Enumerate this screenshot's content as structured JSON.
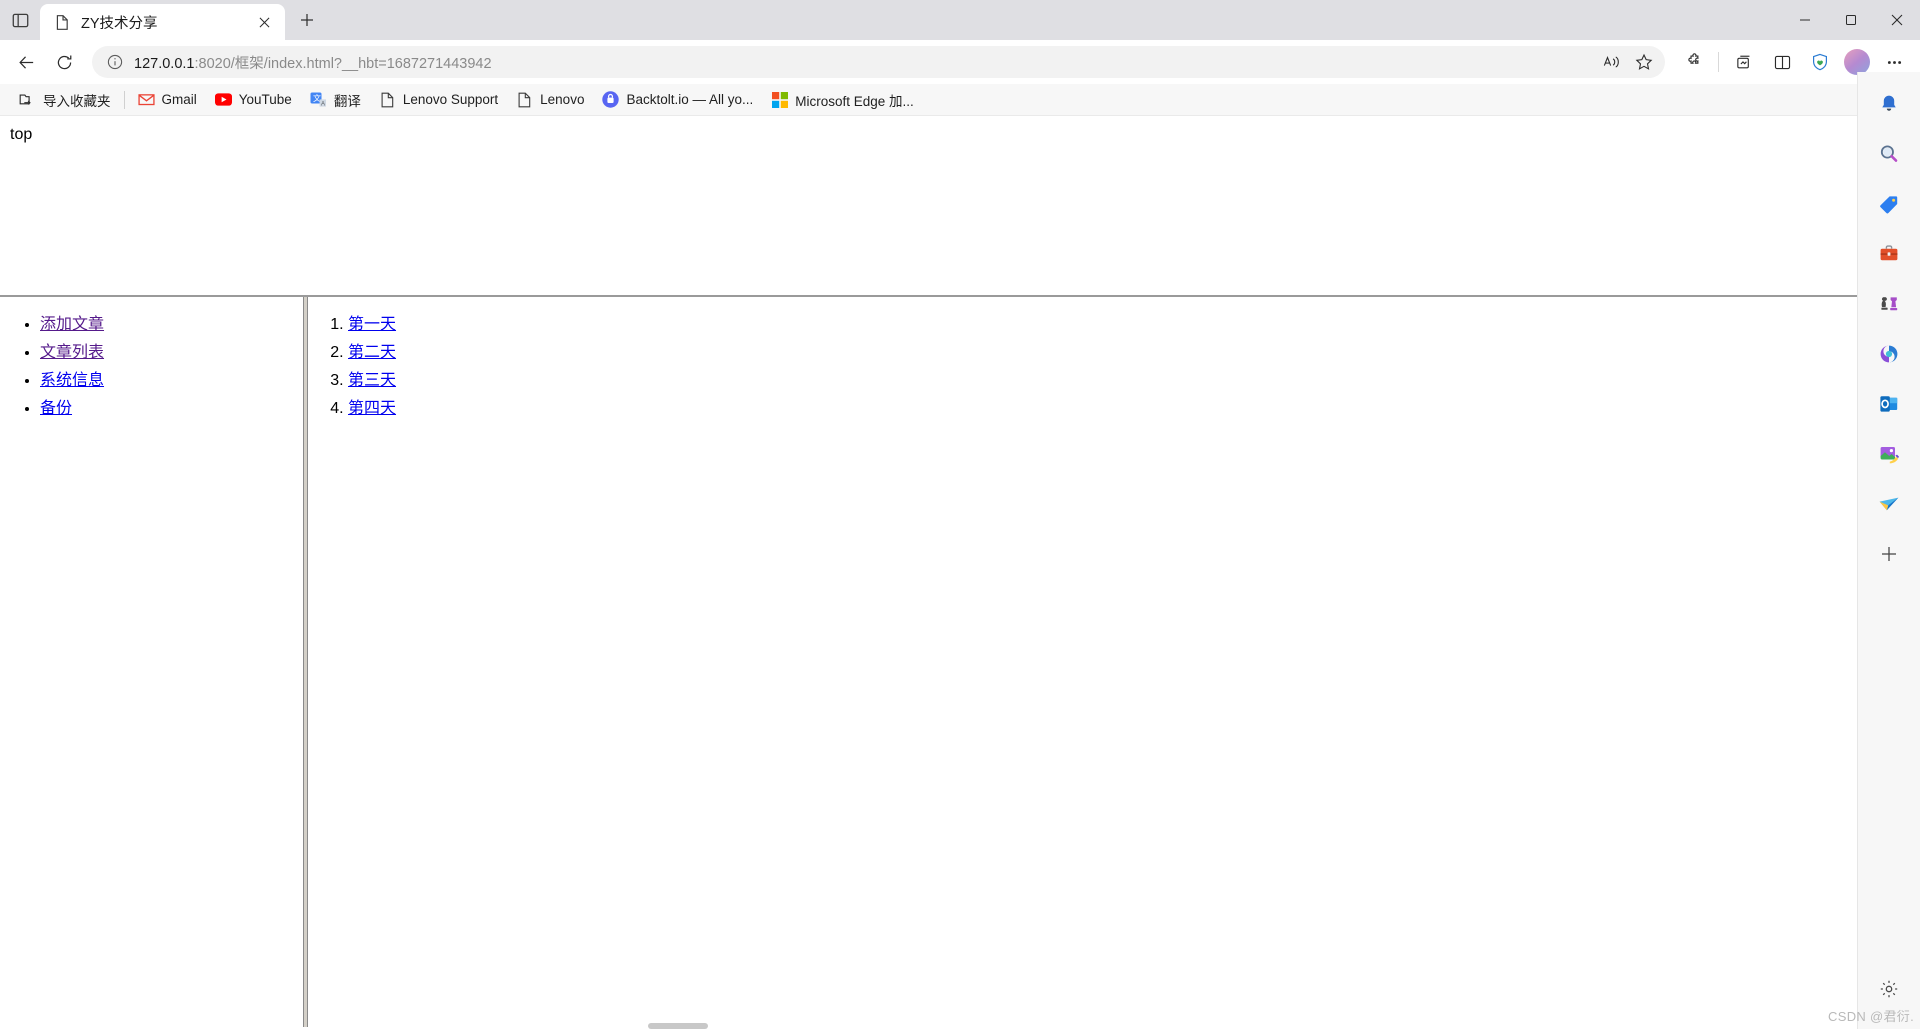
{
  "window": {
    "controls": {
      "minimize": "minimize-icon",
      "maximize": "maximize-icon",
      "close": "close-icon"
    },
    "tab_list_icon": "tab-list-icon"
  },
  "tabs": [
    {
      "title": "ZY技术分享",
      "favicon": "page-icon",
      "close_label": "×",
      "active": true
    }
  ],
  "new_tab": {
    "label": "+"
  },
  "toolbar": {
    "back_icon": "back-arrow-icon",
    "refresh_icon": "refresh-icon",
    "info_icon": "info-circle-icon",
    "url_prefix": "127.0.0.1",
    "url_rest": ":8020/框架/index.html?__hbt=1687271443942",
    "url_full": "127.0.0.1:8020/框架/index.html?__hbt=1687271443942",
    "read_aloud_icon": "read-aloud-icon",
    "favorite_icon": "star-icon",
    "extensions_icon": "puzzle-icon",
    "collections_icon": "collections-icon",
    "split_icon": "split-screen-icon",
    "browser_essentials_icon": "shield-heart-icon",
    "profile_icon": "avatar",
    "settings_more_icon": "ellipsis-icon"
  },
  "bookmarks": [
    {
      "label": "导入收藏夹",
      "icon": "import-favorites-icon"
    },
    {
      "label": "Gmail",
      "icon": "gmail-icon"
    },
    {
      "label": "YouTube",
      "icon": "youtube-icon"
    },
    {
      "label": "翻译",
      "icon": "translate-icon"
    },
    {
      "label": "Lenovo Support",
      "icon": "page-icon"
    },
    {
      "label": "Lenovo",
      "icon": "page-icon"
    },
    {
      "label": "Backtolt.io — All yo...",
      "icon": "backtolt-icon"
    },
    {
      "label": "Microsoft Edge 加...",
      "icon": "microsoft-icon"
    }
  ],
  "page": {
    "top_frame": {
      "text": "top"
    },
    "left_frame": {
      "items": [
        {
          "label": "添加文章",
          "state": "visited"
        },
        {
          "label": "文章列表",
          "state": "visited"
        },
        {
          "label": "系统信息",
          "state": "unvisited"
        },
        {
          "label": "备份",
          "state": "unvisited"
        }
      ]
    },
    "right_frame": {
      "items": [
        {
          "label": "第一天",
          "state": "unvisited"
        },
        {
          "label": "第二天",
          "state": "unvisited"
        },
        {
          "label": "第三天",
          "state": "unvisited"
        },
        {
          "label": "第四天",
          "state": "unvisited"
        }
      ]
    }
  },
  "edgebar": {
    "items": [
      {
        "icon": "notifications-bell-icon"
      },
      {
        "icon": "search-magnifier-icon"
      },
      {
        "icon": "shopping-tag-icon"
      },
      {
        "icon": "tools-briefcase-icon"
      },
      {
        "icon": "games-chess-icon"
      },
      {
        "icon": "microsoft-365-icon"
      },
      {
        "icon": "outlook-icon"
      },
      {
        "icon": "image-creator-icon"
      },
      {
        "icon": "drop-paperplane-icon"
      },
      {
        "icon": "add-plus-icon"
      }
    ],
    "settings": {
      "icon": "gear-icon"
    }
  },
  "watermark": {
    "text": "CSDN @君衍."
  },
  "colors": {
    "link_visited": "#551a8b",
    "link_unvisited": "#0000ee",
    "chrome_titlebar": "#dfdfe3",
    "omnibox_bg": "#f2f2f2",
    "bookmarks_bg": "#f7f7f7"
  }
}
